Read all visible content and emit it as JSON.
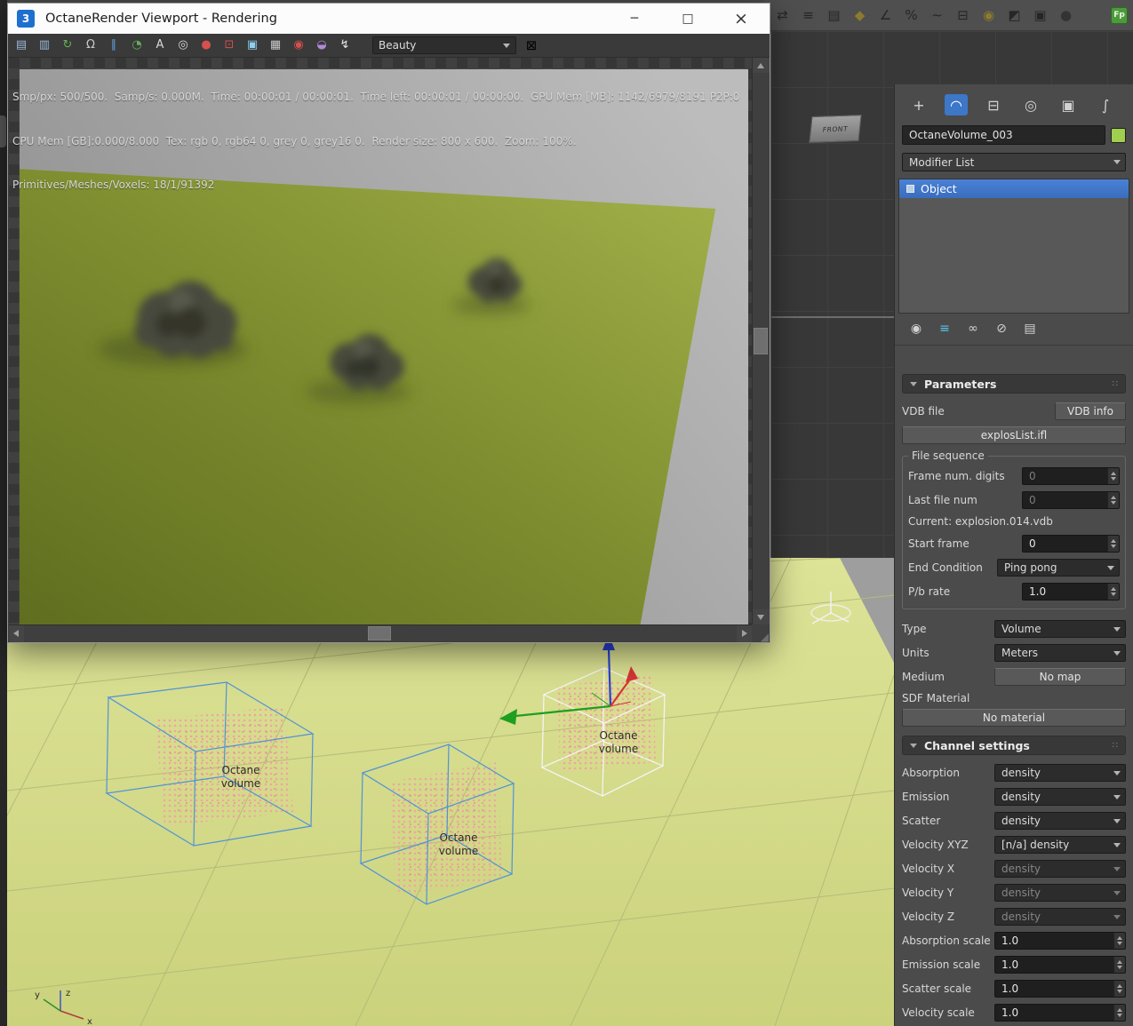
{
  "ui": {
    "minimize": "─",
    "maximize": "□",
    "close": "×",
    "grip": "∷",
    "corner_grip": "◢"
  },
  "octane_window": {
    "title": "OctaneRender Viewport - Rendering",
    "app_badge": "3",
    "toolbar": {
      "render_pass": "Beauty",
      "expand_glyph": "⊠",
      "icons": [
        {
          "name": "export-icon",
          "glyph": "▤",
          "style": "color:#9ab7d8"
        },
        {
          "name": "copy-icon",
          "glyph": "▥",
          "style": "color:#9ab7d8"
        },
        {
          "name": "refresh-icon",
          "glyph": "↻",
          "style": "color:#62b152"
        },
        {
          "name": "lock-resolution-icon",
          "glyph": "Ω",
          "style": "color:#c9c9c9"
        },
        {
          "name": "pause-icon",
          "glyph": "∥",
          "style": "color:#5f9fdc"
        },
        {
          "name": "restart-timer-icon",
          "glyph": "◔",
          "style": "color:#62b152"
        },
        {
          "name": "font-overlay-icon",
          "glyph": "A",
          "style": "color:#d8d8d8"
        },
        {
          "name": "picker-icon",
          "glyph": "◎",
          "style": "color:#d8d8d8"
        },
        {
          "name": "record-icon",
          "glyph": "●",
          "style": "color:#d84f4f"
        },
        {
          "name": "region-render-icon",
          "glyph": "⊡",
          "style": "color:#d84f4f"
        },
        {
          "name": "display-icon",
          "glyph": "▣",
          "style": "color:#8fd0ee"
        },
        {
          "name": "print-icon",
          "glyph": "▦",
          "style": "color:#c8c8c8"
        },
        {
          "name": "camera-icon",
          "glyph": "◉",
          "style": "color:#d84f4f"
        },
        {
          "name": "clay-mode-icon",
          "glyph": "◒",
          "style": "color:#b48ad8"
        },
        {
          "name": "flash-icon",
          "glyph": "↯",
          "style": "color:#e8e8e8"
        }
      ]
    },
    "status_lines": [
      "Smp/px: 500/500.  Samp/s: 0.000M.  Time: 00:00:01 / 00:00:01.  Time left: 00:00:01 / 00:00:00.  GPU Mem [MB]: 1142/6979/8191 P2P:0",
      "CPU Mem [GB]:0.000/8.000  Tex: rgb 0, rgb64 0, grey 0, grey16 0.  Render size: 800 x 600.  Zoom: 100%.",
      "Primitives/Meshes/Voxels: 18/1/91392"
    ]
  },
  "max_toolbar": {
    "fp_badge": "Fp",
    "icons": [
      {
        "name": "mirror-icon",
        "glyph": "⇄",
        "style": "color:#262626"
      },
      {
        "name": "align-icon",
        "glyph": "≡",
        "style": "color:#262626"
      },
      {
        "name": "layer-manager-icon",
        "glyph": "▤",
        "style": "color:#262626"
      },
      {
        "name": "snap-toggle-icon",
        "glyph": "◆",
        "style": "color:#8d7a2e"
      },
      {
        "name": "angle-snap-icon",
        "glyph": "∠",
        "style": "color:#262626"
      },
      {
        "name": "percent-snap-icon",
        "glyph": "%",
        "style": "color:#262626"
      },
      {
        "name": "curve-editor-icon",
        "glyph": "∼",
        "style": "color:#262626"
      },
      {
        "name": "schematic-view-icon",
        "glyph": "⊟",
        "style": "color:#262626"
      },
      {
        "name": "material-editor-icon",
        "glyph": "◉",
        "style": "color:#8d7a2e"
      },
      {
        "name": "render-setup-icon",
        "glyph": "◩",
        "style": "color:#262626"
      },
      {
        "name": "rendered-frame-icon",
        "glyph": "▣",
        "style": "color:#262626"
      },
      {
        "name": "render-production-icon",
        "glyph": "●",
        "style": "color:#333333"
      }
    ]
  },
  "viewport": {
    "front_label": "FRONT",
    "volume_label": "Octane volume",
    "axis": {
      "x": "x",
      "y": "y",
      "z": "z"
    }
  },
  "command_panel": {
    "tabs": [
      {
        "name": "create-tab",
        "glyph": "+"
      },
      {
        "name": "modify-tab",
        "glyph": "◠"
      },
      {
        "name": "hierarchy-tab",
        "glyph": "⊟"
      },
      {
        "name": "motion-tab",
        "glyph": "◎"
      },
      {
        "name": "display-tab",
        "glyph": "▣"
      },
      {
        "name": "utilities-tab",
        "glyph": "∫"
      }
    ],
    "object_name": "OctaneVolume_003",
    "modifier_list_label": "Modifier List",
    "stack_selected": "Object",
    "stack_buttons": [
      {
        "name": "pin-stack-icon",
        "glyph": "◉",
        "style": "color:#d2d2d2"
      },
      {
        "name": "show-end-result-icon",
        "glyph": "≡",
        "style": "color:#58c0e8"
      },
      {
        "name": "make-unique-icon",
        "glyph": "∞",
        "style": "color:#d2d2d2"
      },
      {
        "name": "remove-modifier-icon",
        "glyph": "⊘",
        "style": "color:#d2d2d2"
      },
      {
        "name": "configure-modifier-sets-icon",
        "glyph": "▤",
        "style": "color:#d2d2d2"
      }
    ],
    "parameters": {
      "title": "Parameters",
      "vdb_file_label": "VDB file",
      "vdb_info": "VDB info",
      "file_button": "explosList.ifl",
      "file_sequence_title": "File sequence",
      "frame_digits_label": "Frame num. digits",
      "frame_digits_value": "0",
      "last_file_label": "Last file num",
      "last_file_value": "0",
      "current_text": "Current:  explosion.014.vdb",
      "start_frame_label": "Start frame",
      "start_frame_value": "0",
      "end_condition_label": "End Condition",
      "end_condition_value": "Ping pong",
      "pb_rate_label": "P/b rate",
      "pb_rate_value": "1.0",
      "type_label": "Type",
      "type_value": "Volume",
      "units_label": "Units",
      "units_value": "Meters",
      "medium_label": "Medium",
      "medium_value": "No map",
      "sdf_label": "SDF Material",
      "sdf_value": "No material"
    },
    "channel_settings": {
      "title": "Channel settings",
      "rows": [
        {
          "label": "Absorption",
          "value": "density"
        },
        {
          "label": "Emission",
          "value": "density"
        },
        {
          "label": "Scatter",
          "value": "density"
        },
        {
          "label": "Velocity XYZ",
          "value": "[n/a] density"
        },
        {
          "label": "Velocity X",
          "value": "density"
        },
        {
          "label": "Velocity Y",
          "value": "density"
        },
        {
          "label": "Velocity Z",
          "value": "density"
        },
        {
          "label": "Absorption scale",
          "value": "1.0"
        },
        {
          "label": "Emission scale",
          "value": "1.0"
        },
        {
          "label": "Scatter scale",
          "value": "1.0"
        },
        {
          "label": "Velocity scale",
          "value": "1.0"
        }
      ]
    }
  }
}
